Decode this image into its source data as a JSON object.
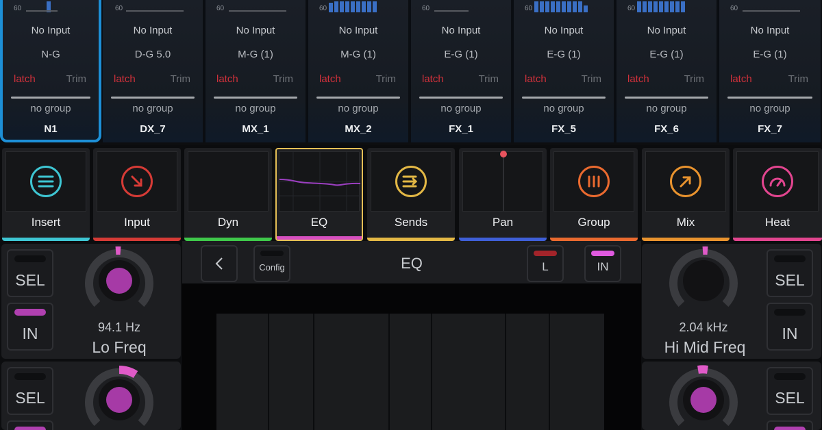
{
  "meter_scale": "60",
  "channels": [
    {
      "input": "No Input",
      "group": "N-G",
      "latch": "latch",
      "trim": "Trim",
      "nogroup": "no group",
      "name": "N1"
    },
    {
      "input": "No Input",
      "group": "D-G 5.0",
      "latch": "latch",
      "trim": "Trim",
      "nogroup": "no group",
      "name": "DX_7"
    },
    {
      "input": "No Input",
      "group": "M-G (1)",
      "latch": "latch",
      "trim": "Trim",
      "nogroup": "no group",
      "name": "MX_1"
    },
    {
      "input": "No Input",
      "group": "M-G (1)",
      "latch": "latch",
      "trim": "Trim",
      "nogroup": "no group",
      "name": "MX_2"
    },
    {
      "input": "No Input",
      "group": "E-G (1)",
      "latch": "latch",
      "trim": "Trim",
      "nogroup": "no group",
      "name": "FX_1"
    },
    {
      "input": "No Input",
      "group": "E-G (1)",
      "latch": "latch",
      "trim": "Trim",
      "nogroup": "no group",
      "name": "FX_5"
    },
    {
      "input": "No Input",
      "group": "E-G (1)",
      "latch": "latch",
      "trim": "Trim",
      "nogroup": "no group",
      "name": "FX_6"
    },
    {
      "input": "No Input",
      "group": "E-G (1)",
      "latch": "latch",
      "trim": "Trim",
      "nogroup": "no group",
      "name": "FX_7"
    }
  ],
  "modes": [
    {
      "label": "Insert",
      "color": "#3ec6d3",
      "icon": "list-circle-icon"
    },
    {
      "label": "Input",
      "color": "#d63b36",
      "icon": "arrow-down-right-icon"
    },
    {
      "label": "Dyn",
      "color": "#3fc84a",
      "icon": "dynamics-graph"
    },
    {
      "label": "EQ",
      "color": "#d64fc0",
      "icon": "eq-curve-graph"
    },
    {
      "label": "Sends",
      "color": "#e3b845",
      "icon": "sends-arrows-icon"
    },
    {
      "label": "Pan",
      "color": "#3f5fd8",
      "icon": "pan-line-graph"
    },
    {
      "label": "Group",
      "color": "#ea6a2f",
      "icon": "group-bars-icon"
    },
    {
      "label": "Mix",
      "color": "#e9932e",
      "icon": "arrow-up-right-icon"
    },
    {
      "label": "Heat",
      "color": "#e2458f",
      "icon": "gauge-icon"
    }
  ],
  "eq": {
    "title": "EQ",
    "config_label": "Config",
    "l_label": "L",
    "in_label": "IN"
  },
  "left_panel": {
    "sel_label": "SEL",
    "in_label": "IN",
    "value": "94.1 Hz",
    "name": "Lo Freq",
    "sel2_label": "SEL"
  },
  "right_panel": {
    "sel_label": "SEL",
    "in_label": "IN",
    "value": "2.04 kHz",
    "name": "Hi Mid Freq",
    "sel2_label": "SEL"
  },
  "accent_color": "#b040b0"
}
